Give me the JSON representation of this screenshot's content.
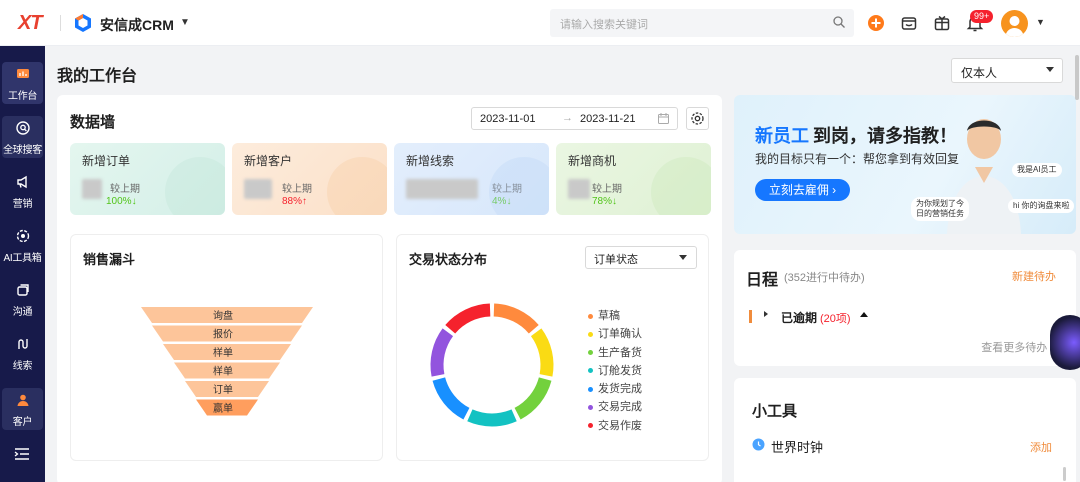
{
  "header": {
    "logo": "XT",
    "brand_name": "安信成CRM",
    "search_placeholder": "请输入搜索关键词",
    "notification_badge": "99+"
  },
  "sidebar": {
    "items": [
      {
        "label": "工作台",
        "icon": "dashboard-icon"
      },
      {
        "label": "全球搜客",
        "icon": "search-globe-icon"
      },
      {
        "label": "营销",
        "icon": "megaphone-icon"
      },
      {
        "label": "AI工具箱",
        "icon": "ai-gear-icon"
      },
      {
        "label": "沟通",
        "icon": "chat-icon"
      },
      {
        "label": "线索",
        "icon": "clue-icon"
      },
      {
        "label": "客户",
        "icon": "customer-icon"
      }
    ]
  },
  "page": {
    "title": "我的工作台",
    "scope_select": "仅本人"
  },
  "data_wall": {
    "title": "数据墙",
    "date_start": "2023-11-01",
    "date_arrow": "→",
    "date_end": "2023-11-21",
    "cards": [
      {
        "title": "新增订单",
        "compare": "较上期",
        "pct": "100%",
        "dir": "down",
        "arrow": "↓"
      },
      {
        "title": "新增客户",
        "compare": "较上期",
        "pct": "88%",
        "dir": "up",
        "arrow": "↑"
      },
      {
        "title": "新增线索",
        "compare": "较上期",
        "pct": "4%",
        "dir": "down",
        "arrow": "↓"
      },
      {
        "title": "新增商机",
        "compare": "较上期",
        "pct": "78%",
        "dir": "down",
        "arrow": "↓"
      }
    ]
  },
  "sales_funnel": {
    "title": "销售漏斗",
    "stages": [
      "询盘",
      "报价",
      "样单",
      "样单",
      "订单",
      "赢单"
    ]
  },
  "trade_status": {
    "title": "交易状态分布",
    "select": "订单状态",
    "legend": [
      {
        "label": "草稿",
        "color": "#ff8a3d"
      },
      {
        "label": "订单确认",
        "color": "#fadb14"
      },
      {
        "label": "生产备货",
        "color": "#73d13d"
      },
      {
        "label": "订舱发货",
        "color": "#13c2c2"
      },
      {
        "label": "发货完成",
        "color": "#1890ff"
      },
      {
        "label": "交易完成",
        "color": "#9254de"
      },
      {
        "label": "交易作废",
        "color": "#f5222d"
      }
    ]
  },
  "banner": {
    "title_highlight": "新员工",
    "title_rest": "到岗，请多指教！",
    "subtitle": "我的目标只有一个：帮您拿到有效回复",
    "button": "立刻去雇佣 ›",
    "tag_ai": "我是AI员工",
    "tag_plan": "为你规划了今日的营销任务",
    "tag_reply": "hi 你的询盘来啦"
  },
  "schedule": {
    "title": "日程",
    "count": "(352进行中待办)",
    "new_todo": "新建待办",
    "overdue_label": "已逾期",
    "overdue_count": "(20项)",
    "view_more": "查看更多待办 ›"
  },
  "tools": {
    "title": "小工具",
    "world_clock": "世界时钟",
    "add": "添加"
  }
}
